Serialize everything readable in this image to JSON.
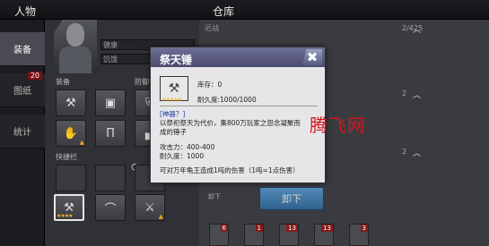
{
  "header": {
    "character_title": "人物",
    "storage_title": "仓库"
  },
  "nav": {
    "items": [
      {
        "label": "装备",
        "badge": ""
      },
      {
        "label": "图纸",
        "badge": "20"
      },
      {
        "label": "统计",
        "badge": ""
      }
    ]
  },
  "character": {
    "stat_rows": [
      "健康",
      "饥饿"
    ],
    "equip_label": "装备",
    "defense_label": "防御",
    "quickbar_label": "快捷栏",
    "quickslot_count": "1"
  },
  "storage": {
    "first_row": "近战",
    "counts": [
      "2/425",
      "2",
      "2"
    ]
  },
  "dialog": {
    "title": "祭天锤",
    "stock": "库存：0",
    "durability": "耐久度:1000/1000",
    "tag": "[神器？]",
    "description_line1": "以祭祀祭天为代价，集800万玩家之怨念凝聚而",
    "description_line2": "成的锤子",
    "attack": "攻击力：400-400",
    "durability_value": "耐久度：1000",
    "effect": "可对万年龟王造成1吨的伤害（1吨=1点伤害）"
  },
  "buttons": {
    "unequip": "卸下",
    "unequip_behind": "卸下",
    "close_symbol": "✖"
  },
  "bottom_badges": [
    "6",
    "1",
    "13",
    "13",
    "3"
  ],
  "watermark": "腾飞网",
  "colors": {
    "accent_blue": "#3a86c8",
    "header_purple": "#5b5c82",
    "star_gold": "#f2b632",
    "badge_red": "#8b1a1a",
    "watermark_red": "#d4141f"
  }
}
